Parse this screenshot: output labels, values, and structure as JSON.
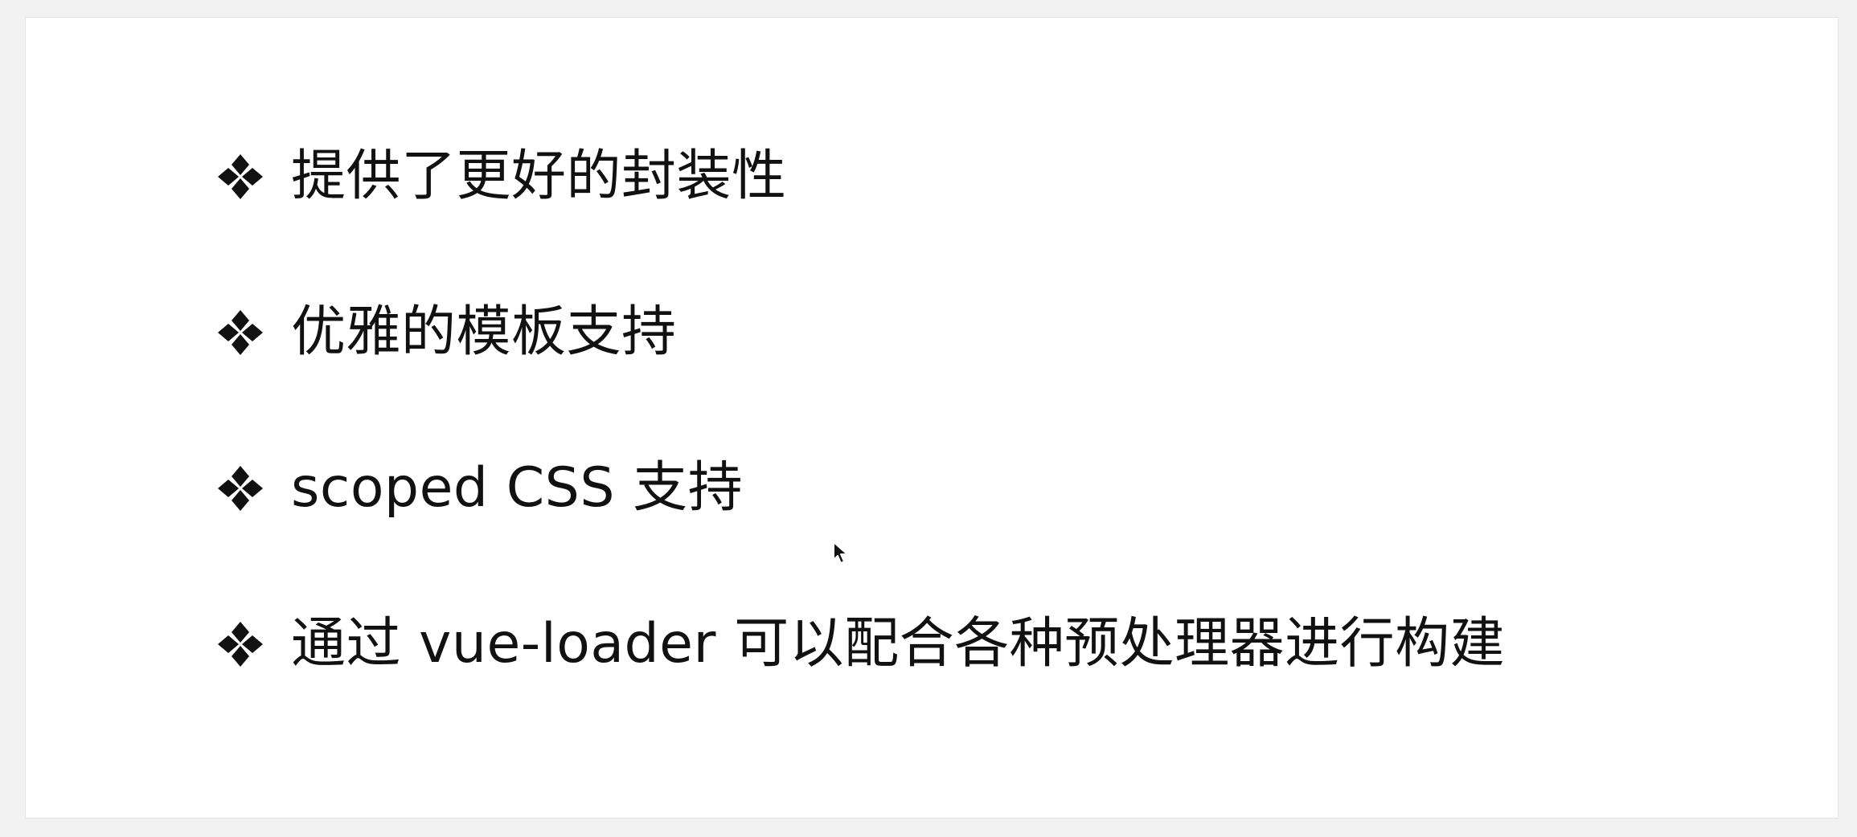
{
  "slide": {
    "bullets": [
      {
        "icon": "four-diamonds-bullet-icon",
        "text": "提供了更好的封装性"
      },
      {
        "icon": "four-diamonds-bullet-icon",
        "text": "优雅的模板支持"
      },
      {
        "icon": "four-diamonds-bullet-icon",
        "text": "scoped CSS 支持"
      },
      {
        "icon": "four-diamonds-bullet-icon",
        "text": "通过 vue-loader 可以配合各种预处理器进行构建"
      }
    ]
  },
  "colors": {
    "background": "#f2f2f2",
    "slide": "#ffffff",
    "text": "#111111"
  }
}
